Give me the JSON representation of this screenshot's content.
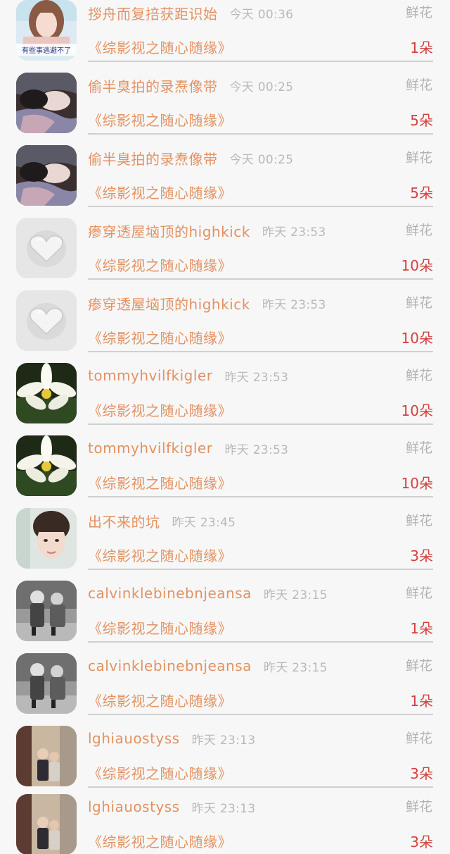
{
  "gift_records": [
    {
      "user": "拶舟而复掊获距识始",
      "time": "今天 00:36",
      "gift_type": "鲜花",
      "book": "《综影视之随心随缘》",
      "count": "1朵",
      "avatar": "avatar-girl-caption",
      "avatar_caption": "有些事逃避不了"
    },
    {
      "user": "偷半臭拍的录焘像带",
      "time": "今天 00:25",
      "gift_type": "鲜花",
      "book": "《综影视之随心随缘》",
      "count": "5朵",
      "avatar": "avatar-sleeping-woman"
    },
    {
      "user": "偷半臭拍的录焘像带",
      "time": "今天 00:25",
      "gift_type": "鲜花",
      "book": "《综影视之随心随缘》",
      "count": "5朵",
      "avatar": "avatar-sleeping-woman"
    },
    {
      "user": "瘆穿透屋垴顶的highkick",
      "time": "昨天 23:53",
      "gift_type": "鲜花",
      "book": "《综影视之随心随缘》",
      "count": "10朵",
      "avatar": "avatar-glass-heart"
    },
    {
      "user": "瘆穿透屋垴顶的highkick",
      "time": "昨天 23:53",
      "gift_type": "鲜花",
      "book": "《综影视之随心随缘》",
      "count": "10朵",
      "avatar": "avatar-glass-heart"
    },
    {
      "user": "tommyhvilfkigler",
      "time": "昨天 23:53",
      "gift_type": "鲜花",
      "book": "《综影视之随心随缘》",
      "count": "10朵",
      "avatar": "avatar-white-flower"
    },
    {
      "user": "tommyhvilfkigler",
      "time": "昨天 23:53",
      "gift_type": "鲜花",
      "book": "《综影视之随心随缘》",
      "count": "10朵",
      "avatar": "avatar-white-flower"
    },
    {
      "user": "出不来的坑",
      "time": "昨天 23:45",
      "gift_type": "鲜花",
      "book": "《综影视之随心随缘》",
      "count": "3朵",
      "avatar": "avatar-young-man"
    },
    {
      "user": "calvinklebinebnjeansa",
      "time": "昨天 23:15",
      "gift_type": "鲜花",
      "book": "《综影视之随心随缘》",
      "count": "1朵",
      "avatar": "avatar-kids-bw"
    },
    {
      "user": "calvinklebinebnjeansa",
      "time": "昨天 23:15",
      "gift_type": "鲜花",
      "book": "《综影视之随心随缘》",
      "count": "1朵",
      "avatar": "avatar-kids-bw"
    },
    {
      "user": "lghiauostyss",
      "time": "昨天 23:13",
      "gift_type": "鲜花",
      "book": "《综影视之随心随缘》",
      "count": "3朵",
      "avatar": "avatar-couple-street"
    },
    {
      "user": "lghiauostyss",
      "time": "昨天 23:13",
      "gift_type": "鲜花",
      "book": "《综影视之随心随缘》",
      "count": "3朵",
      "avatar": "avatar-couple-street"
    }
  ]
}
